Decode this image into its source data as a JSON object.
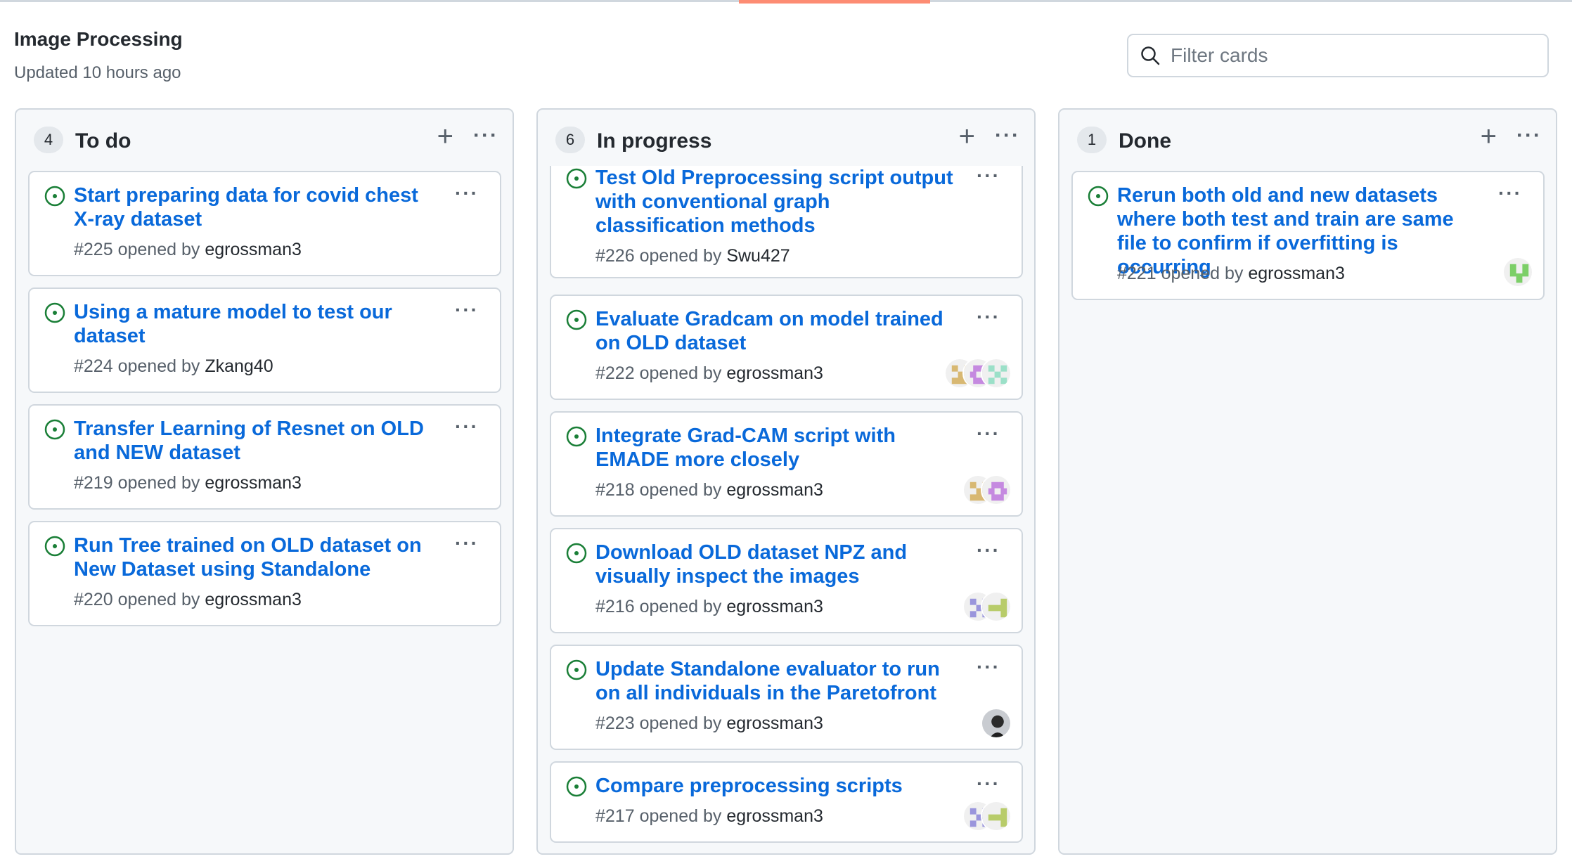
{
  "project": {
    "title": "Image Processing",
    "updated": "Updated 10 hours ago"
  },
  "filter": {
    "placeholder": "Filter cards"
  },
  "colors": {
    "link": "#0969da",
    "open_issue_green": "#1a7f37",
    "tab_accent": "#fd8c73"
  },
  "columns": [
    {
      "count": "4",
      "name": "To do",
      "add_label": "+",
      "more_label": "···",
      "cards": [
        {
          "title": "Start preparing data for covid chest X-ray dataset",
          "number": "#225",
          "opened_by": "opened by",
          "user": "egrossman3",
          "menu": "···"
        },
        {
          "title": "Using a mature model to test our dataset",
          "number": "#224",
          "opened_by": "opened by",
          "user": "Zkang40",
          "menu": "···"
        },
        {
          "title": "Transfer Learning of Resnet on OLD and NEW dataset",
          "number": "#219",
          "opened_by": "opened by",
          "user": "egrossman3",
          "menu": "···"
        },
        {
          "title": "Run Tree trained on OLD dataset on New Dataset using Standalone",
          "number": "#220",
          "opened_by": "opened by",
          "user": "egrossman3",
          "menu": "···"
        }
      ]
    },
    {
      "count": "6",
      "name": "In progress",
      "add_label": "+",
      "more_label": "···",
      "cards": [
        {
          "title": "Test Old Preprocessing script output with conventional graph classification methods",
          "number": "#226",
          "opened_by": "opened by",
          "user": "Swu427",
          "menu": "···",
          "avatars": []
        },
        {
          "title": "Evaluate Gradcam on model trained on OLD dataset",
          "number": "#222",
          "opened_by": "opened by",
          "user": "egrossman3",
          "menu": "···",
          "avatars": [
            "identicon-tan",
            "identicon-purple",
            "identicon-teal"
          ]
        },
        {
          "title": "Integrate Grad-CAM script with EMADE more closely",
          "number": "#218",
          "opened_by": "opened by",
          "user": "egrossman3",
          "menu": "···",
          "avatars": [
            "identicon-tan",
            "identicon-purple"
          ]
        },
        {
          "title": "Download OLD dataset NPZ and visually inspect the images",
          "number": "#216",
          "opened_by": "opened by",
          "user": "egrossman3",
          "menu": "···",
          "avatars": [
            "identicon-blue",
            "identicon-olive"
          ]
        },
        {
          "title": "Update Standalone evaluator to run on all individuals in the Paretofront",
          "number": "#223",
          "opened_by": "opened by",
          "user": "egrossman3",
          "menu": "···",
          "avatars": [
            "photo-avatar"
          ]
        },
        {
          "title": "Compare preprocessing scripts",
          "number": "#217",
          "opened_by": "opened by",
          "user": "egrossman3",
          "menu": "···",
          "avatars": [
            "identicon-blue",
            "identicon-olive"
          ]
        }
      ]
    },
    {
      "count": "1",
      "name": "Done",
      "add_label": "+",
      "more_label": "···",
      "cards": [
        {
          "title": "Rerun both old and new datasets where both test and train are same file to confirm if overfitting is occurring",
          "number": "#221",
          "opened_by": "opened by",
          "user": "egrossman3",
          "menu": "···",
          "avatars": [
            "identicon-green"
          ]
        }
      ]
    }
  ]
}
